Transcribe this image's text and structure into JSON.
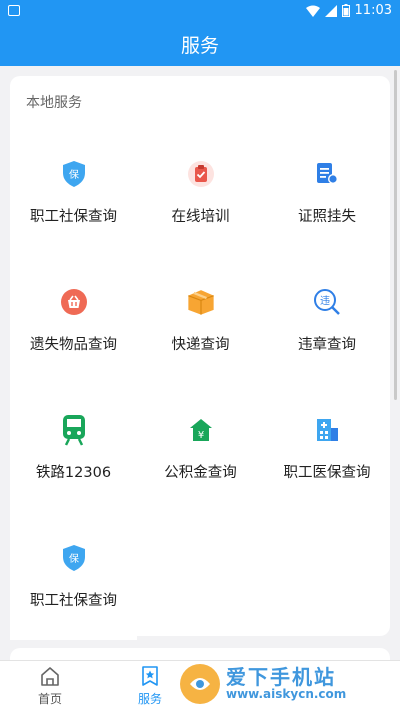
{
  "status_bar": {
    "time": "11:03"
  },
  "header": {
    "title": "服务"
  },
  "section": {
    "title": "本地服务"
  },
  "services": [
    {
      "label": "职工社保查询",
      "icon": "shield-icon"
    },
    {
      "label": "在线培训",
      "icon": "clipboard-check-icon"
    },
    {
      "label": "证照挂失",
      "icon": "document-badge-icon"
    },
    {
      "label": "遗失物品查询",
      "icon": "basket-icon"
    },
    {
      "label": "快递查询",
      "icon": "package-icon"
    },
    {
      "label": "违章查询",
      "icon": "violation-search-icon"
    },
    {
      "label": "铁路12306",
      "icon": "train-icon"
    },
    {
      "label": "公积金查询",
      "icon": "house-yuan-icon"
    },
    {
      "label": "职工医保查询",
      "icon": "hospital-icon"
    },
    {
      "label": "职工社保查询",
      "icon": "shield-icon"
    }
  ],
  "tabs": [
    {
      "label": "首页",
      "icon": "home-icon",
      "active": false
    },
    {
      "label": "服务",
      "icon": "star-bookmark-icon",
      "active": true
    },
    {
      "label": "",
      "icon": "",
      "active": false
    },
    {
      "label": "",
      "icon": "",
      "active": false
    }
  ],
  "watermark": {
    "title": "爱下手机站",
    "url": "www.aiskycn.com"
  },
  "colors": {
    "primary": "#2196f3",
    "shield": "#3ea6f0",
    "red_icon": "#e9574b",
    "orange_icon": "#f7a533",
    "blue_icon": "#2f7fe6",
    "green_icon": "#19a65a"
  }
}
